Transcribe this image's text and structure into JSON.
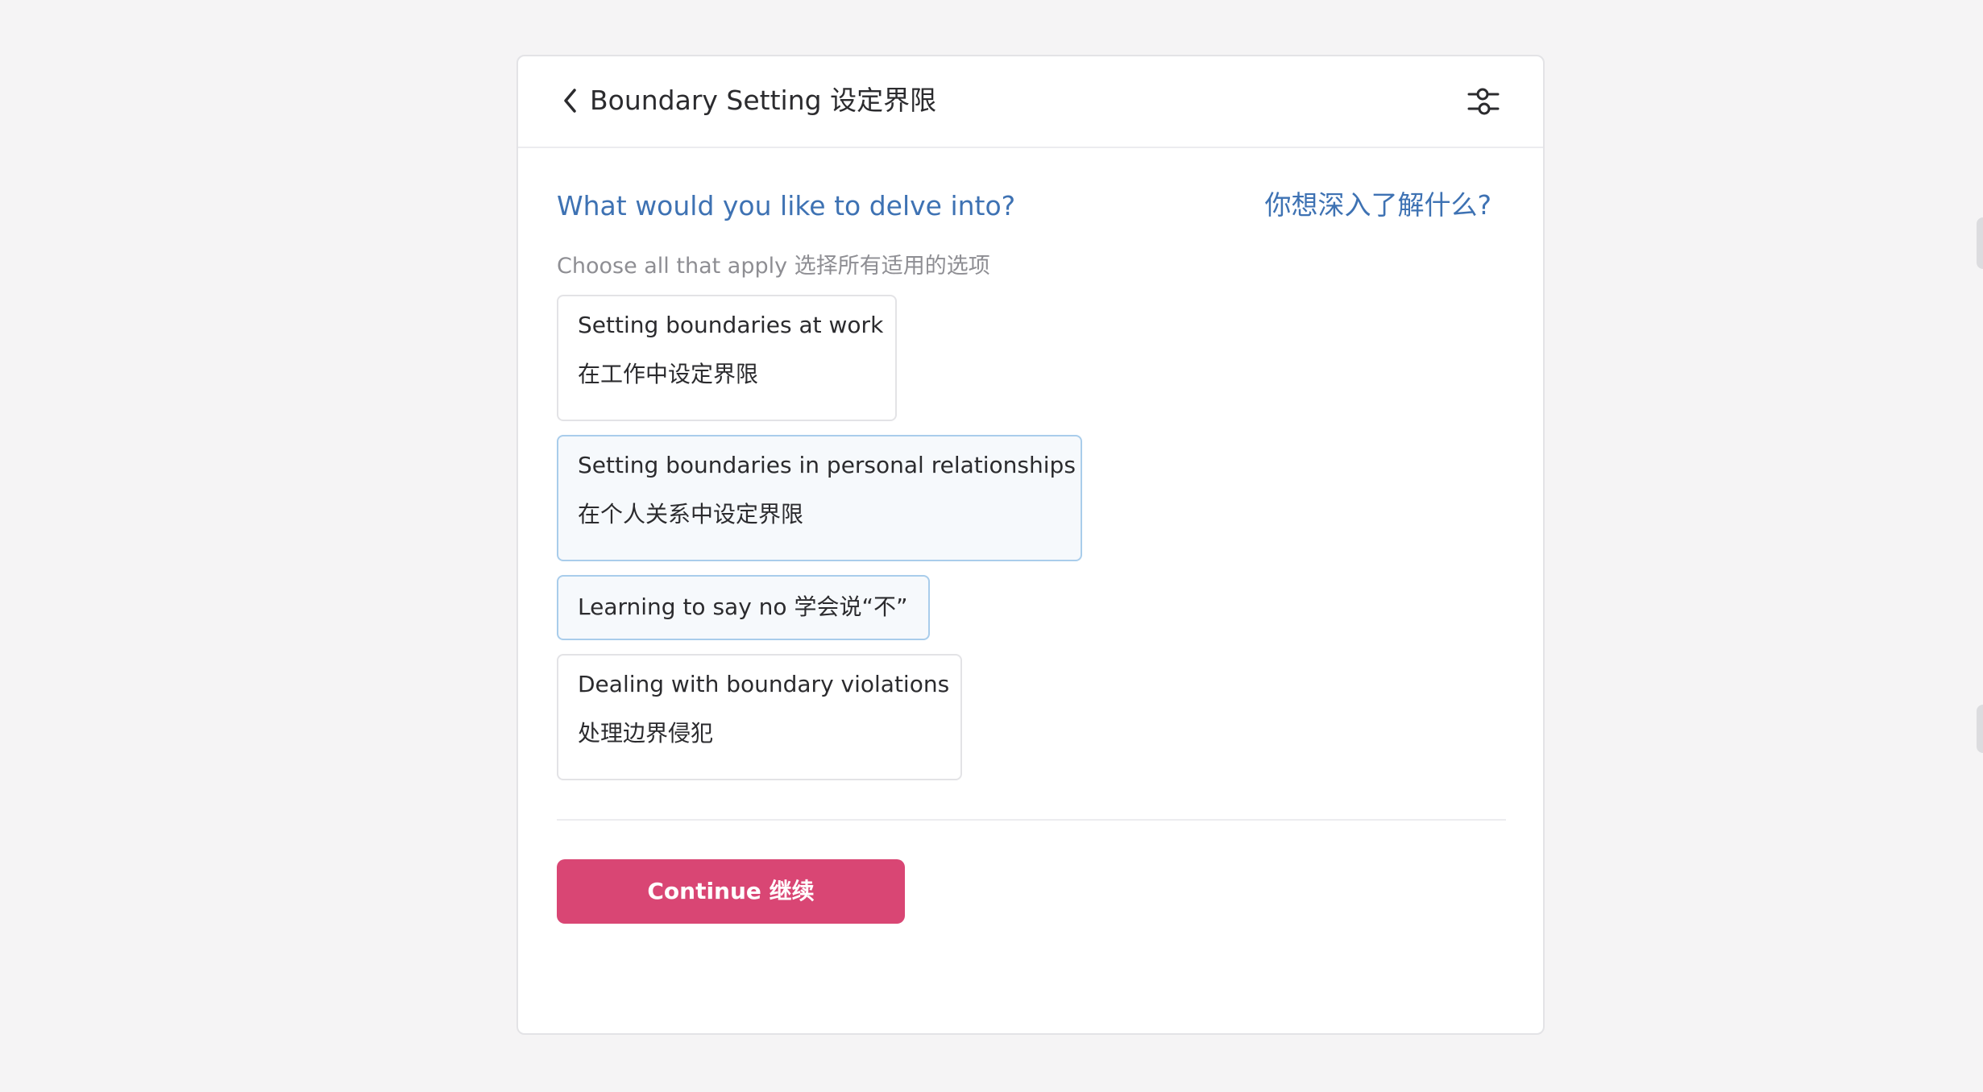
{
  "header": {
    "back_icon": "chevron-left-icon",
    "title": "Boundary Setting  设定界限",
    "settings_icon": "sliders-icon"
  },
  "question": {
    "en": "What would you like to delve into?",
    "zh": "你想深入了解什么?"
  },
  "hint": "Choose all that apply  选择所有适用的选项",
  "options": [
    {
      "en": "Setting boundaries at work",
      "zh": "在工作中设定界限",
      "selected": false
    },
    {
      "en": "Setting boundaries in personal relationships",
      "zh": "在个人关系中设定界限",
      "selected": true
    },
    {
      "en": "Learning to say no  学会说“不”",
      "zh": "",
      "selected": true
    },
    {
      "en": "Dealing with boundary violations",
      "zh": "处理边界侵犯",
      "selected": false
    }
  ],
  "continue_label": "Continue  继续",
  "colors": {
    "accent_blue": "#3e72b3",
    "continue_button": "#d94674",
    "selected_border": "#a9cdeb",
    "selected_bg": "#f6f9fc",
    "page_bg": "#f5f4f5"
  }
}
